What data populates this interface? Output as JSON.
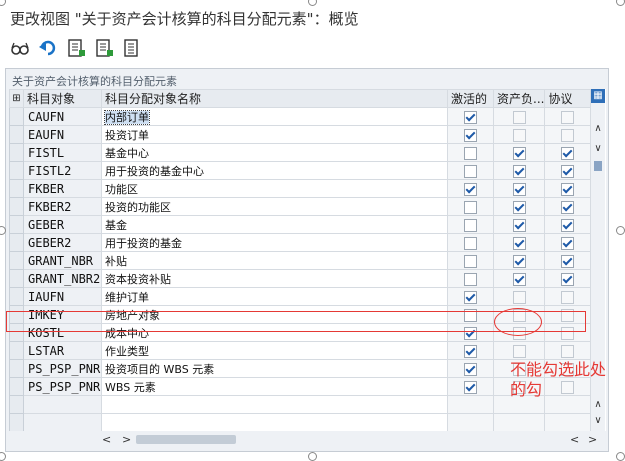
{
  "window": {
    "title": "更改视图 \"关于资产会计核算的科目分配元素\"：概览"
  },
  "toolbar": {
    "buttons": [
      "glasses-icon",
      "undo-icon",
      "select-all-icon",
      "deselect-icon",
      "deselect-block-icon"
    ]
  },
  "panel": {
    "title": "关于资产会计核算的科目分配元素",
    "columns": {
      "obj": "科目对象",
      "name": "科目分配对象名称",
      "active": "激活的",
      "asset": "资产负...",
      "agreement": "协议"
    },
    "rows": [
      {
        "obj": "CAUFN",
        "name": "内部订单",
        "active": true,
        "asset": false,
        "agreement": false
      },
      {
        "obj": "EAUFN",
        "name": "投资订单",
        "active": true,
        "asset": false,
        "agreement": false
      },
      {
        "obj": "FISTL",
        "name": "基金中心",
        "active": false,
        "asset": true,
        "agreement": true
      },
      {
        "obj": "FISTL2",
        "name": "用于投资的基金中心",
        "active": false,
        "asset": true,
        "agreement": true
      },
      {
        "obj": "FKBER",
        "name": "功能区",
        "active": true,
        "asset": true,
        "agreement": true
      },
      {
        "obj": "FKBER2",
        "name": "投资的功能区",
        "active": false,
        "asset": true,
        "agreement": true
      },
      {
        "obj": "GEBER",
        "name": "基金",
        "active": false,
        "asset": true,
        "agreement": true
      },
      {
        "obj": "GEBER2",
        "name": "用于投资的基金",
        "active": false,
        "asset": true,
        "agreement": true
      },
      {
        "obj": "GRANT_NBR",
        "name": "补贴",
        "active": false,
        "asset": true,
        "agreement": true
      },
      {
        "obj": "GRANT_NBR2",
        "name": "资本投资补贴",
        "active": false,
        "asset": true,
        "agreement": true
      },
      {
        "obj": "IAUFN",
        "name": "维护订单",
        "active": true,
        "asset": false,
        "agreement": false
      },
      {
        "obj": "IMKEY",
        "name": "房地产对象",
        "active": false,
        "asset": false,
        "agreement": false
      },
      {
        "obj": "KOSTL",
        "name": "成本中心",
        "active": true,
        "asset": false,
        "agreement": false
      },
      {
        "obj": "LSTAR",
        "name": "作业类型",
        "active": true,
        "asset": false,
        "agreement": false
      },
      {
        "obj": "PS_PSP_PNR",
        "name": "投资项目的 WBS 元素",
        "active": true,
        "asset": false,
        "agreement": false
      },
      {
        "obj": "PS_PSP_PNR",
        "name": "WBS 元素",
        "active": true,
        "asset": false,
        "agreement": false
      }
    ]
  },
  "annotation": {
    "text": "不能勾选此处的勾"
  }
}
